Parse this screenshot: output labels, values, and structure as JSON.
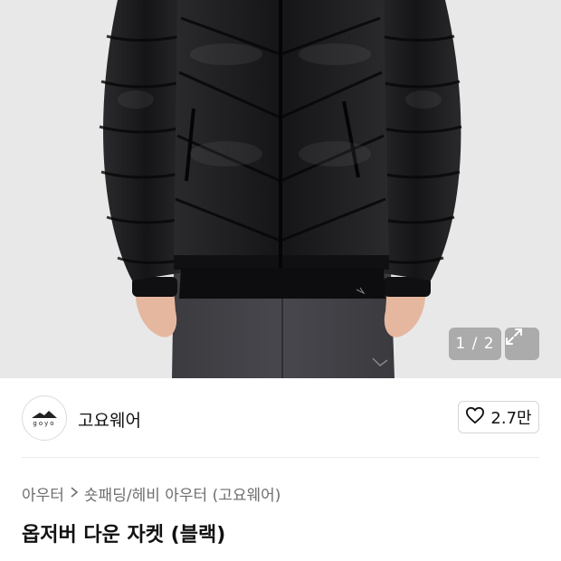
{
  "gallery": {
    "current": "1",
    "total": "2",
    "counter_text": "1 / 2",
    "image_alt": "black puffer down jacket worn by model"
  },
  "brand": {
    "logo_text": "goyo",
    "name": "고요웨어"
  },
  "like": {
    "count": "2.7만"
  },
  "breadcrumb": {
    "items": [
      "아우터",
      "숏패딩/헤비 아우터 (고요웨어)"
    ]
  },
  "product": {
    "title": "옵저버 다운 자켓 (블랙)"
  },
  "icons": {
    "heart": "heart-icon",
    "expand": "expand-icon",
    "chevron": "chevron-right-icon"
  },
  "colors": {
    "hero_bg": "#e8e8e9",
    "jacket": "#1a1a1c",
    "text_primary": "#111111",
    "text_secondary": "#6e6e6e"
  }
}
